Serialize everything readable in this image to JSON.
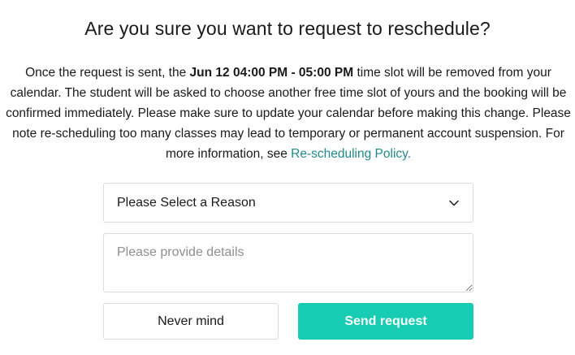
{
  "dialog": {
    "title": "Are you sure you want to request to reschedule?",
    "message": {
      "part1": "Once the request is sent, the ",
      "slot": "Jun 12 04:00 PM - 05:00 PM",
      "part2": " time slot will be removed from your calendar. The student will be asked to choose another free time slot of yours and the booking will be confirmed immediately. Please make sure to update your calendar before making this change. Please note re-scheduling too many classes may lead to temporary or permanent account suspension. For more information, see ",
      "policy_link": "Re-scheduling Policy."
    },
    "reason_select": {
      "selected": "Please Select a Reason",
      "icon": "chevron-down-icon"
    },
    "details_input": {
      "value": "",
      "placeholder": "Please provide details"
    },
    "buttons": {
      "cancel_label": "Never mind",
      "send_label": "Send request"
    },
    "colors": {
      "accent": "#16cdb3",
      "link": "#1f8a8a",
      "border": "#dcdcdc",
      "text": "#1a1a1a"
    }
  }
}
